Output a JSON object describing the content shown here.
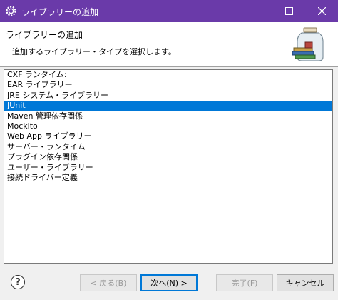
{
  "window": {
    "title": "ライブラリーの追加",
    "accent": "#6a3aa9"
  },
  "header": {
    "title": "ライブラリーの追加",
    "description": "追加するライブラリー・タイプを選択します。"
  },
  "list": {
    "items": [
      "CXF ランタイム:",
      "EAR ライブラリー",
      "JRE システム・ライブラリー",
      "JUnit",
      "Maven 管理依存関係",
      "Mockito",
      "Web App ライブラリー",
      "サーバー・ランタイム",
      "プラグイン依存関係",
      "ユーザー・ライブラリー",
      "接続ドライバー定義"
    ],
    "selected": "JUnit",
    "selection_color": "#0078d7"
  },
  "buttons": {
    "back": "< 戻る(B)",
    "next": "次へ(N) >",
    "finish": "完了(F)",
    "cancel": "キャンセル"
  },
  "icons": {
    "app": "eclipse-gear-icon",
    "minimize": "minimize-icon",
    "maximize": "maximize-icon",
    "close": "close-icon",
    "header": "library-jar-icon",
    "help": "help-icon"
  }
}
